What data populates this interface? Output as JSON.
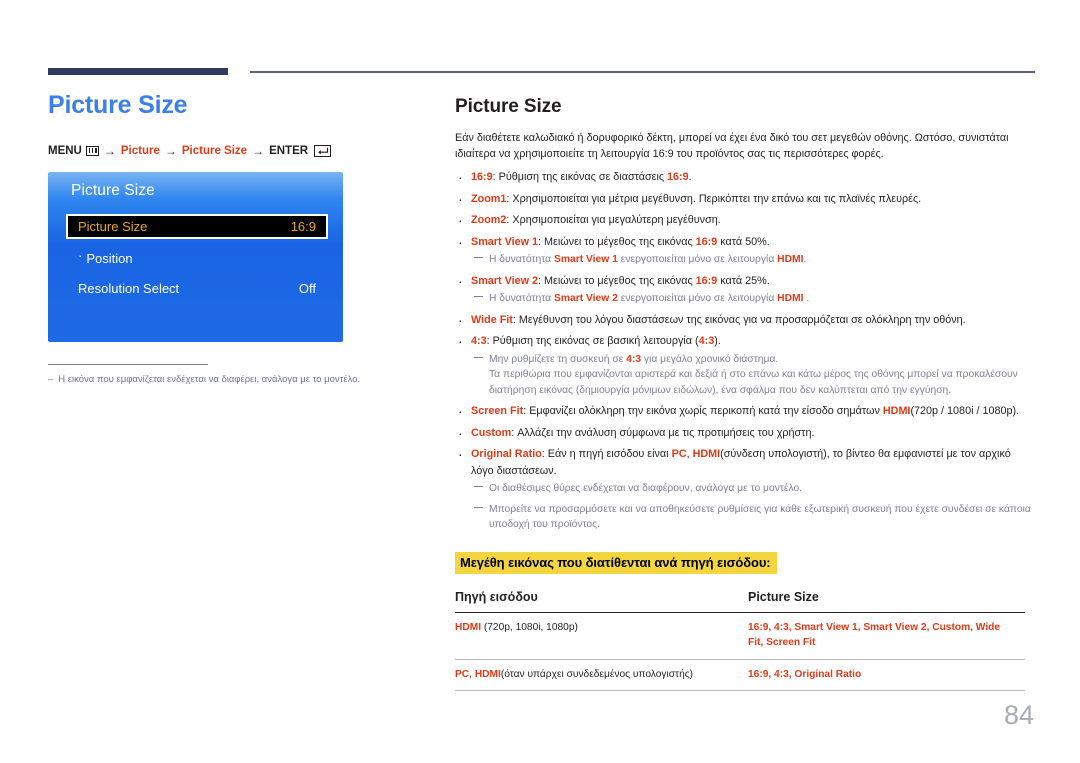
{
  "page": {
    "number": "84"
  },
  "left": {
    "title": "Picture Size",
    "breadcrumb": {
      "menu_label": "MENU",
      "menu_icon": "menu-bars-icon",
      "arrow": "→",
      "item1": "Picture",
      "item2": "Picture Size",
      "enter_label": "ENTER",
      "enter_icon": "enter-arrow-icon"
    },
    "osd": {
      "title": "Picture Size",
      "rows": [
        {
          "label": "Picture Size",
          "value": "16:9",
          "selected": true,
          "prefix": ""
        },
        {
          "label": "Position",
          "value": "",
          "selected": false,
          "prefix": "·"
        },
        {
          "label": "Resolution Select",
          "value": "Off",
          "selected": false,
          "prefix": ""
        }
      ]
    },
    "note": {
      "dash": "–",
      "text": "Η εικόνα που εμφανίζεται ενδέχεται να διαφέρει, ανάλογα με το μοντέλο."
    }
  },
  "right": {
    "title": "Picture Size",
    "intro": "Εάν διαθέτετε καλωδιακό ή δορυφορικό δέκτη, μπορεί να έχει ένα δικό του σετ μεγεθών οθόνης. Ωστόσο, συνιστάται ιδιαίτερα να χρησιμοποιείτε τη λειτουργία 16:9 του προϊόντος σας τις περισσότερες φορές.",
    "bullets": [
      {
        "term": "16:9",
        "text_a": ": Ρύθμιση της εικόνας σε διαστάσεις ",
        "red_mid": "16:9",
        "text_b": "."
      },
      {
        "term": "Zoom1",
        "text_a": ": Χρησιμοποιείται για μέτρια μεγέθυνση. Περικόπτει την επάνω και τις πλαϊνές πλευρές.",
        "red_mid": "",
        "text_b": ""
      },
      {
        "term": "Zoom2",
        "text_a": ": Χρησιμοποιείται για μεγαλύτερη μεγέθυνση.",
        "red_mid": "",
        "text_b": ""
      },
      {
        "term": "Smart View 1",
        "text_a": ": Μειώνει το μέγεθος της εικόνας ",
        "red_mid": "16:9",
        "text_b": " κατά 50%."
      },
      {
        "term": "Smart View 2",
        "text_a": ": Μειώνει το μέγεθος της εικόνας ",
        "red_mid": "16:9",
        "text_b": " κατά 25%."
      },
      {
        "term": "Wide Fit",
        "text_a": ": Μεγέθυνση του λόγου διαστάσεων της εικόνας για να προσαρμόζεται σε ολόκληρη την οθόνη.",
        "red_mid": "",
        "text_b": ""
      },
      {
        "term": "4:3",
        "text_a": ": Ρύθμιση της εικόνας σε βασική λειτουργία (",
        "red_mid": "4:3",
        "text_b": ")."
      },
      {
        "term": "Screen Fit",
        "text_a": ": Εμφανίζει ολόκληρη την εικόνα χωρίς περικοπή κατά την είσοδο σημάτων ",
        "red_mid": "HDMI",
        "text_b": "(720p / 1080i / 1080p)."
      },
      {
        "term": "Custom",
        "text_a": ": Αλλάζει την ανάλυση σύμφωνα με τις προτιμήσεις του χρήστη.",
        "red_mid": "",
        "text_b": ""
      },
      {
        "term": "Original Ratio",
        "text_a": ": Εάν η πηγή εισόδου είναι ",
        "red_mid": "PC",
        "text_b": ", ",
        "red_mid2": "HDMI",
        "text_c": "(σύνδεση υπολογιστή), το βίντεο θα εμφανιστεί με τον αρχικό λόγο διαστάσεων."
      }
    ],
    "subnotes": {
      "sv1_a": "Η δυνατότητα ",
      "sv1_term": "Smart View 1",
      "sv1_b": " ενεργοποιείται μόνο σε λειτουργία ",
      "sv1_hdmi": "HDMI",
      "sv1_c": ".",
      "sv2_a": "Η δυνατότητα ",
      "sv2_term": "Smart View 2",
      "sv2_b": " ενεργοποιείται μόνο σε λειτουργία ",
      "sv2_hdmi": "HDMI",
      "sv2_c": " .",
      "ratio43_a": "Μην ρυθμίζετε τη συσκευή σε ",
      "ratio43_term": "4:3",
      "ratio43_b": " για μεγάλο χρονικό διάστημα.",
      "ratio43_cont": "Τα περιθώρια που εμφανίζονται αριστερά και δεξιά ή στο επάνω και κάτω μέρος της οθόνης μπορεί να προκαλέσουν διατήρηση εικόνας (δημιουργία μόνιμων ειδώλων), ένα σφάλμα που δεν καλύπτεται από την εγγύηση.",
      "ports": "Οι διαθέσιμες θύρες ενδέχεται να διαφέρουν, ανάλογα με το μοντέλο.",
      "save": "Μπορείτε να προσαρμόσετε και να αποθηκεύσετε ρυθμίσεις για κάθε εξωτερική συσκευή που έχετε συνδέσει σε κάποια υποδοχή του προϊόντος."
    },
    "yellow_heading": "Μεγέθη εικόνας που διατίθενται ανά πηγή εισόδου:",
    "table": {
      "headers": [
        "Πηγή εισόδου",
        "Picture Size"
      ],
      "rows": [
        {
          "source_red": "HDMI",
          "source_rest": " (720p, 1080i, 1080p)",
          "source_red2": "",
          "source_rest2": "",
          "values": "16:9, 4:3, Smart View 1, Smart View 2, Custom, Wide Fit, Screen Fit"
        },
        {
          "source_red": "PC",
          "source_rest": ", ",
          "source_red2": "HDMI",
          "source_rest2": "(όταν υπάρχει συνδεδεμένος υπολογιστής)",
          "values": "16:9, 4:3, Original Ratio"
        }
      ]
    }
  },
  "colors": {
    "accent_blue": "#3c7fe8",
    "accent_red": "#e03a17",
    "navy_bar": "#313a5e",
    "highlight_yellow": "#f3d63f",
    "osd_blue": "#1964e3",
    "osd_selected_text": "#e8a820",
    "note_gray": "#7e7f96"
  }
}
